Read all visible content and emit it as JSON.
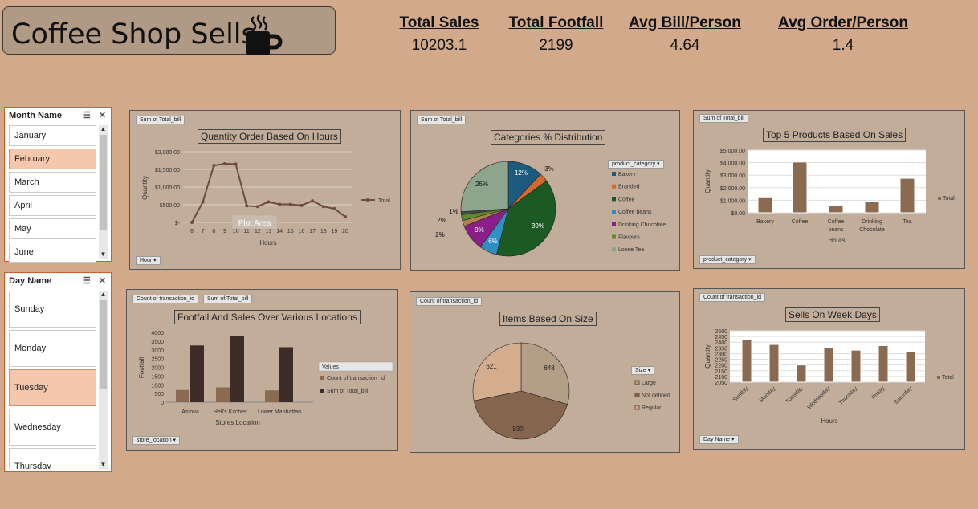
{
  "header": {
    "title": "Coffee Shop Sells",
    "icon": "coffee-cup-icon"
  },
  "kpis": [
    {
      "label": "Total Sales",
      "value": "10203.1"
    },
    {
      "label": "Total Footfall",
      "value": "2199"
    },
    {
      "label": "Avg Bill/Person",
      "value": "4.64"
    },
    {
      "label": "Avg Order/Person",
      "value": "1.4"
    }
  ],
  "month_slicer": {
    "title": "Month Name",
    "items": [
      "January",
      "February",
      "March",
      "April",
      "May",
      "June"
    ],
    "selected": "February"
  },
  "day_slicer": {
    "title": "Day Name",
    "items": [
      "Sunday",
      "Monday",
      "Tuesday",
      "Wednesday",
      "Thursday"
    ],
    "selected": "Tuesday"
  },
  "colors": {
    "background": "#d2a98a",
    "panel": "#c2ad9a",
    "brown_dark": "#3e2c28",
    "brown_mid": "#8b6a52",
    "brown_line": "#6e4b3c"
  },
  "chart_data": [
    {
      "id": "hours",
      "type": "line",
      "title": "Quantity Order Based On Hours",
      "field_button": "Sum of Total_bill",
      "axis_button": "Hour",
      "xlabel": "Hours",
      "ylabel": "Quantity",
      "overlay_text": "Plot Area",
      "x": [
        6,
        7,
        8,
        9,
        10,
        11,
        12,
        13,
        14,
        15,
        16,
        17,
        18,
        19,
        20
      ],
      "series": [
        {
          "name": "Total",
          "values": [
            0,
            580,
            1610,
            1660,
            1650,
            470,
            450,
            580,
            510,
            510,
            480,
            610,
            450,
            390,
            160
          ]
        }
      ],
      "yticks": [
        "$-",
        "$500.00",
        "$1,000.00",
        "$1,500.00",
        "$2,000.00"
      ],
      "ylim": [
        0,
        2000
      ]
    },
    {
      "id": "categories",
      "type": "pie",
      "title": "Categories % Distribution",
      "field_button": "Sum of Total_bill",
      "legend_button": "product_category",
      "categories": [
        "Bakery",
        "Branded",
        "Coffee",
        "Coffee beans",
        "Drinking Chocolate",
        "Flavours",
        "Loose Tea"
      ],
      "values": [
        12,
        3,
        39,
        6,
        9,
        2,
        1
      ],
      "colors": [
        "#1c5a7e",
        "#d2692d",
        "#1b5a22",
        "#2f8fc2",
        "#8a1f88",
        "#5f8a2a",
        "#8da48d"
      ],
      "extra_slices": [
        {
          "value": 2,
          "color": "#b08050"
        },
        {
          "value": 26,
          "color": "#8da48d"
        }
      ],
      "labels": [
        "12%",
        "3%",
        "39%",
        "6%",
        "9%",
        "2%",
        "2%",
        "1%",
        "26%"
      ]
    },
    {
      "id": "top5",
      "type": "bar",
      "title": "Top 5 Products Based On Sales",
      "field_button": "Sum of Total_bill",
      "axis_button": "product_category",
      "xlabel": "Hours",
      "ylabel": "Quantity",
      "categories": [
        "Bakery",
        "Coffee",
        "Coffee beans",
        "Drinking Chocolate",
        "Tea"
      ],
      "series": [
        {
          "name": "Total",
          "values": [
            1200,
            4050,
            600,
            900,
            2750
          ]
        }
      ],
      "yticks": [
        "$0.00",
        "$1,000.00",
        "$2,000.00",
        "$3,000.00",
        "$4,000.00",
        "$5,000.00"
      ],
      "ylim": [
        0,
        5000
      ]
    },
    {
      "id": "locations",
      "type": "bar",
      "title": "Footfall And Sales Over Various Locations",
      "field_buttons": [
        "Count of transaction_id",
        "Sum of Total_bill"
      ],
      "axis_button": "store_location",
      "legend_title": "Values",
      "xlabel": "Stores Location",
      "ylabel": "Footfall",
      "categories": [
        "Astoria",
        "Hell's Kitchen",
        "Lower Manhattan"
      ],
      "series": [
        {
          "name": "Count of transaction_id",
          "values": [
            700,
            850,
            680
          ]
        },
        {
          "name": "Sum of Total_bill",
          "values": [
            3250,
            3800,
            3150
          ]
        }
      ],
      "yticks": [
        "0",
        "500",
        "1000",
        "1500",
        "2000",
        "2500",
        "3000",
        "3500",
        "4000"
      ],
      "ylim": [
        0,
        4000
      ]
    },
    {
      "id": "size",
      "type": "pie",
      "title": "Items Based On Size",
      "field_button": "Count of transaction_id",
      "legend_button": "Size",
      "categories": [
        "Large",
        "Not defined",
        "Regular"
      ],
      "values": [
        648,
        930,
        621
      ],
      "colors": [
        "#b39e87",
        "#86654f",
        "#d4ad8f"
      ]
    },
    {
      "id": "weekdays",
      "type": "bar",
      "title": "Sells On Week Days",
      "field_button": "Count of transaction_id",
      "axis_button": "Day Name",
      "xlabel": "Hours",
      "ylabel": "Quantity",
      "categories": [
        "Sunday",
        "Monday",
        "Tuesday",
        "Wednesday",
        "Thursday",
        "Friday",
        "Saturday"
      ],
      "series": [
        {
          "name": "Total",
          "values": [
            2420,
            2380,
            2200,
            2350,
            2330,
            2370,
            2320
          ]
        }
      ],
      "yticks": [
        "2050",
        "2100",
        "2150",
        "2200",
        "2250",
        "2300",
        "2350",
        "2400",
        "2450",
        "2500"
      ],
      "ylim": [
        2050,
        2500
      ]
    }
  ]
}
